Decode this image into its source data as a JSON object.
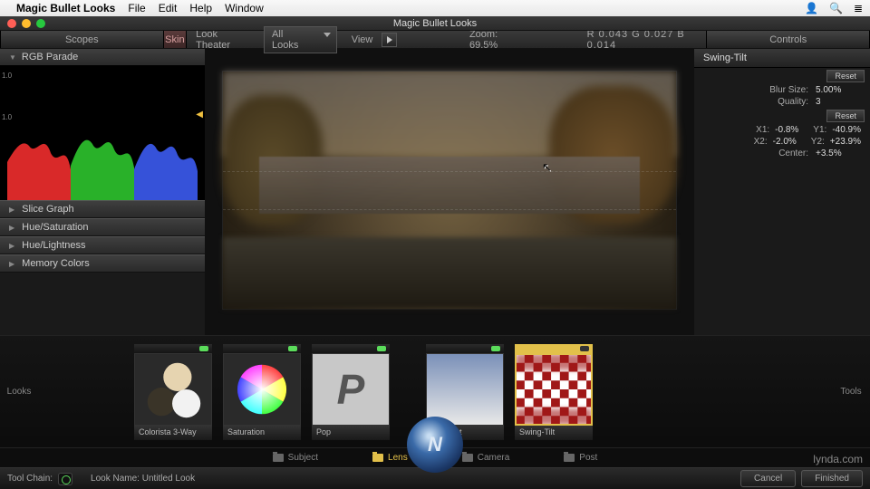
{
  "mac_menu": {
    "app": "Magic Bullet Looks",
    "items": [
      "File",
      "Edit",
      "Help",
      "Window"
    ]
  },
  "window_title": "Magic Bullet Looks",
  "header": {
    "scopes": "Scopes",
    "skin": "Skin",
    "look_theater": "Look Theater",
    "all_looks": "All Looks",
    "view": "View",
    "zoom_label": "Zoom:",
    "zoom_value": "69.5%",
    "rgb_readout": "R 0.043   G 0.027   B 0.014",
    "controls": "Controls"
  },
  "scopes_panel": {
    "section": "RGB Parade",
    "collapsed": [
      "Slice Graph",
      "Hue/Saturation",
      "Hue/Lightness",
      "Memory Colors"
    ],
    "axis_top": "1.0",
    "axis_mid": "1.0"
  },
  "controls_panel": {
    "title": "Swing-Tilt",
    "reset": "Reset",
    "blur_size_label": "Blur Size:",
    "blur_size_value": "5.00%",
    "quality_label": "Quality:",
    "quality_value": "3",
    "x1_label": "X1:",
    "x1_value": "-0.8%",
    "y1_label": "Y1:",
    "y1_value": "-40.9%",
    "x2_label": "X2:",
    "x2_value": "-2.0%",
    "y2_label": "Y2:",
    "y2_value": "+23.9%",
    "center_label": "Center:",
    "center_value": "+3.5%"
  },
  "tools": {
    "looks_side": "Looks",
    "tools_side": "Tools",
    "cards": [
      {
        "name": "Colorista 3-Way"
      },
      {
        "name": "Saturation"
      },
      {
        "name": "Pop"
      },
      {
        "name": "Gradient"
      },
      {
        "name": "Swing-Tilt"
      }
    ],
    "stages": [
      {
        "name": "Subject",
        "active": false
      },
      {
        "name": "Lens",
        "active": true
      },
      {
        "name": "Camera",
        "active": false
      },
      {
        "name": "Post",
        "active": false
      }
    ]
  },
  "status": {
    "tool_chain": "Tool Chain:",
    "look_name_label": "Look Name:",
    "look_name_value": "Untitled Look",
    "cancel": "Cancel",
    "finished": "Finished"
  },
  "watermark": "N",
  "lynda": "lynda.com"
}
